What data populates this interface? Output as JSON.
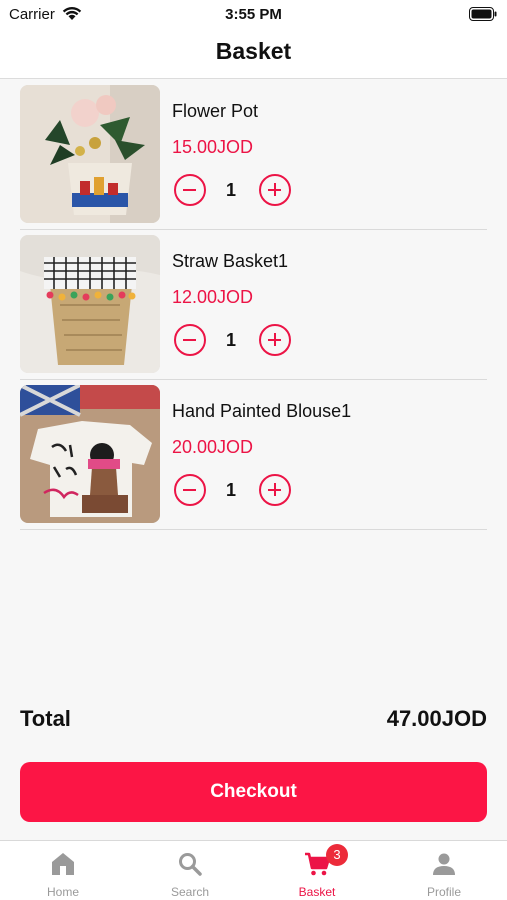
{
  "status": {
    "carrier": "Carrier",
    "time": "3:55 PM"
  },
  "header": {
    "title": "Basket"
  },
  "items": [
    {
      "name": "Flower Pot",
      "price": "15.00JOD",
      "quantity": "1"
    },
    {
      "name": "Straw Basket1",
      "price": "12.00JOD",
      "quantity": "1"
    },
    {
      "name": "Hand Painted Blouse1",
      "price": "20.00JOD",
      "quantity": "1"
    }
  ],
  "summary": {
    "total_label": "Total",
    "total_value": "47.00JOD"
  },
  "checkout": {
    "label": "Checkout"
  },
  "tabbar": {
    "tabs": [
      {
        "label": "Home",
        "icon": "home-icon"
      },
      {
        "label": "Search",
        "icon": "search-icon"
      },
      {
        "label": "Basket",
        "icon": "cart-icon",
        "badge": "3",
        "active": true
      },
      {
        "label": "Profile",
        "icon": "person-icon"
      }
    ]
  },
  "colors": {
    "accent": "#ec1446",
    "button": "#fc1545",
    "badge": "#ec2b3a",
    "inactive": "#9a9a9a"
  }
}
